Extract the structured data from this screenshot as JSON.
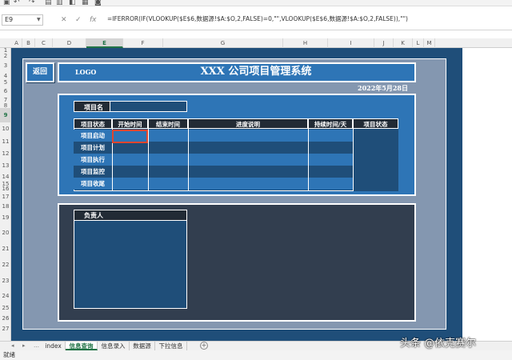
{
  "formula_bar": {
    "name_box": "E9",
    "cancel_icon": "✕",
    "enter_icon": "✓",
    "fx_label": "fx",
    "formula": "=IFERROR(IF(VLOOKUP($E$6,数据源!$A:$O,2,FALSE)=0,\"\",VLOOKUP($E$6,数据源!$A:$O,2,FALSE)),\"\")"
  },
  "columns": [
    "A",
    "B",
    "C",
    "D",
    "E",
    "F",
    "G",
    "H",
    "I",
    "J",
    "K",
    "L",
    "M"
  ],
  "selected_column": "E",
  "rows": [
    "1",
    "2",
    "3",
    "4",
    "5",
    "6",
    "7",
    "8",
    "9",
    "10",
    "11",
    "12",
    "13",
    "14",
    "15",
    "16",
    "17",
    "18",
    "19",
    "20",
    "21",
    "22",
    "23",
    "24",
    "25",
    "26",
    "27"
  ],
  "selected_row": "9",
  "dashboard": {
    "back_button": "返回",
    "logo": "LOGO",
    "title": "XXX 公司项目管理系统",
    "date": "2022年5月28日",
    "project_name_label": "项目名",
    "project_name_value": "",
    "table": {
      "headers": [
        "项目状态",
        "开始时间",
        "结束时间",
        "进度说明",
        "持续时间/天",
        "项目状态"
      ],
      "stages": [
        "项目启动",
        "项目计划",
        "项目执行",
        "项目监控",
        "项目收尾"
      ]
    },
    "owner_label": "负责人",
    "owner_value": ""
  },
  "sheet_tabs": [
    {
      "label": "index",
      "active": false
    },
    {
      "label": "信息查询",
      "active": true
    },
    {
      "label": "信息录入",
      "active": false
    },
    {
      "label": "数据源",
      "active": false
    },
    {
      "label": "下拉信息",
      "active": false
    }
  ],
  "add_sheet_icon": "+",
  "status_text": "就绪",
  "watermark": "头条 @依克赛尔",
  "colors": {
    "frame": "#1f4e79",
    "accent": "#2e75b6",
    "inner_bg": "#8497b0",
    "dark_panel": "#323e4f",
    "header_cell": "#222b35",
    "selection": "#217346",
    "active_cell_border": "#e0452e"
  }
}
